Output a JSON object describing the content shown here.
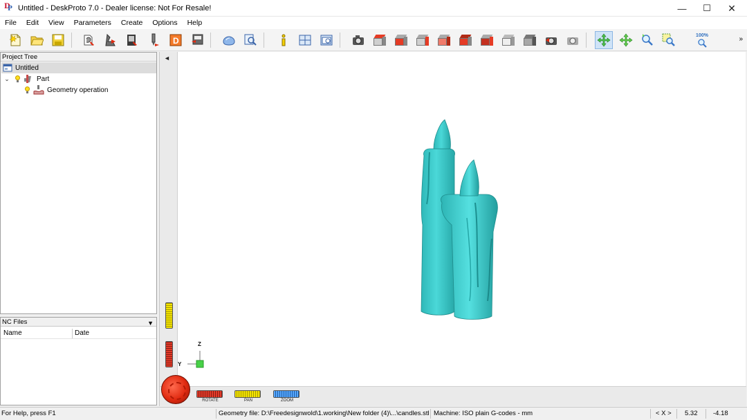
{
  "window": {
    "title": "Untitled - DeskProto 7.0 - Dealer license: Not For Resale!",
    "controls": {
      "minimize": "—",
      "maximize": "☐",
      "close": "✕"
    }
  },
  "menu": [
    "File",
    "Edit",
    "View",
    "Parameters",
    "Create",
    "Options",
    "Help"
  ],
  "toolbar": {
    "zoom_label": "100%",
    "overflow": "»",
    "icons": [
      "new-file-icon",
      "open-file-icon",
      "save-icon",
      "part-params-icon",
      "operation-params-icon",
      "machine-params-icon",
      "cutter-icon",
      "drawing-icon",
      "export-nc-icon",
      "simulate-icon",
      "preview-icon",
      "info-icon",
      "layout-icon",
      "view-window-icon",
      "screenshot-icon",
      "view-top-icon",
      "view-front-icon",
      "view-right-icon",
      "view-left-icon",
      "view-back-icon",
      "view-bottom-icon",
      "view-iso-icon",
      "view-shaded-icon",
      "redraw-icon",
      "render-icon",
      "rotate-icon",
      "pan-icon",
      "zoom-icon",
      "zoom-window-icon",
      "zoom-100-icon"
    ]
  },
  "project_tree": {
    "header": "Project Tree",
    "root": "Untitled",
    "part": "Part",
    "operation": "Geometry operation",
    "expand": "⌄"
  },
  "nc_files": {
    "header": "NC Files",
    "dropdown": "▼",
    "columns": [
      "Name",
      "Date"
    ]
  },
  "viewport": {
    "collapse": "◄",
    "axis_z": "Z",
    "axis_y": "Y",
    "dials": {
      "rotate": "ROTATE",
      "pan": "PAN",
      "zoom": "ZOOM"
    },
    "model_color": "#3cc6c6"
  },
  "statusbar": {
    "help": "For Help, press F1",
    "geometry": "Geometry file: D:\\Freedesignwold\\1.working\\New folder (4)\\...\\candles.stl",
    "machine": "Machine: ISO plain G-codes - mm",
    "axis": "< X >",
    "x": "5.32",
    "y": "-4.18"
  }
}
